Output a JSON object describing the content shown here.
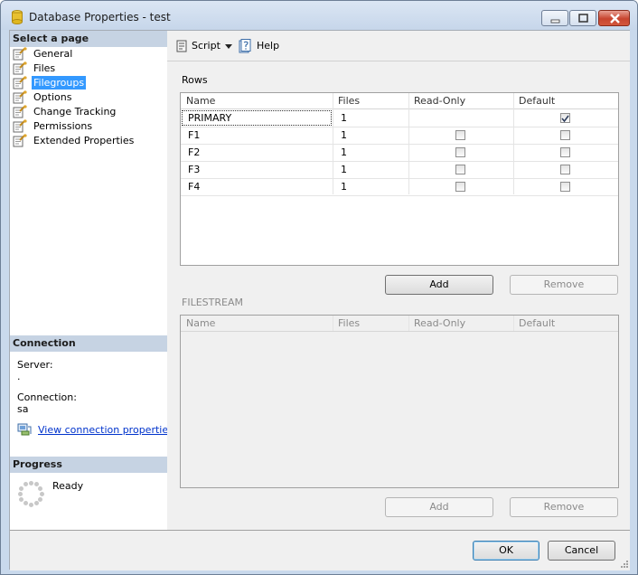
{
  "window": {
    "title": "Database Properties - test",
    "title_icon": "database-icon"
  },
  "left": {
    "select_page_header": "Select a page",
    "pages": [
      {
        "label": "General",
        "icon": "page-wrench-icon",
        "selected": false
      },
      {
        "label": "Files",
        "icon": "page-wrench-icon",
        "selected": false
      },
      {
        "label": "Filegroups",
        "icon": "page-wrench-icon",
        "selected": true
      },
      {
        "label": "Options",
        "icon": "page-wrench-icon",
        "selected": false
      },
      {
        "label": "Change Tracking",
        "icon": "page-wrench-icon",
        "selected": false
      },
      {
        "label": "Permissions",
        "icon": "page-wrench-icon",
        "selected": false
      },
      {
        "label": "Extended Properties",
        "icon": "page-wrench-icon",
        "selected": false
      }
    ],
    "connection": {
      "header": "Connection",
      "server_label": "Server:",
      "server_value": ".",
      "connection_label": "Connection:",
      "connection_value": "sa",
      "link_label": "View connection properties"
    },
    "progress": {
      "header": "Progress",
      "status": "Ready"
    }
  },
  "toolbar": {
    "script_label": "Script",
    "help_label": "Help"
  },
  "rows_section": {
    "label": "Rows",
    "columns": [
      "Name",
      "Files",
      "Read-Only",
      "Default"
    ],
    "rows": [
      {
        "name": "PRIMARY",
        "files": "1",
        "read_only": null,
        "default": true
      },
      {
        "name": "F1",
        "files": "1",
        "read_only": false,
        "default": false
      },
      {
        "name": "F2",
        "files": "1",
        "read_only": false,
        "default": false
      },
      {
        "name": "F3",
        "files": "1",
        "read_only": false,
        "default": false
      },
      {
        "name": "F4",
        "files": "1",
        "read_only": false,
        "default": false
      }
    ],
    "add_label": "Add",
    "remove_label": "Remove"
  },
  "filestream_section": {
    "label": "FILESTREAM",
    "columns": [
      "Name",
      "Files",
      "Read-Only",
      "Default"
    ],
    "add_label": "Add",
    "remove_label": "Remove"
  },
  "footer": {
    "ok_label": "OK",
    "cancel_label": "Cancel"
  },
  "colors": {
    "selected": "#3399ff",
    "section_header": "#c6d3e3",
    "link": "#0033cc"
  }
}
